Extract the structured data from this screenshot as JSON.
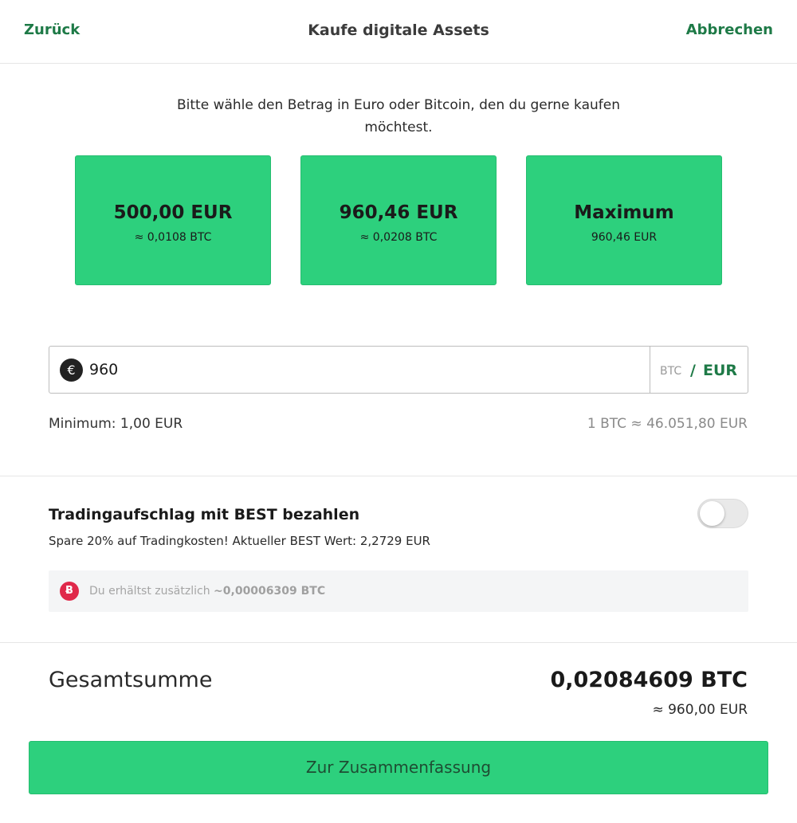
{
  "header": {
    "back_label": "Zurück",
    "title": "Kaufe digitale Assets",
    "cancel_label": "Abbrechen"
  },
  "intro_text": "Bitte wähle den Betrag in Euro oder Bitcoin, den du gerne kaufen möchtest.",
  "presets": [
    {
      "amount": "500,00 EUR",
      "sub": "≈ 0,0108 BTC"
    },
    {
      "amount": "960,46 EUR",
      "sub": "≈ 0,0208 BTC"
    },
    {
      "amount": "Maximum",
      "sub": "960,46 EUR"
    }
  ],
  "amount_input": {
    "currency_icon": "euro-icon",
    "value": "960",
    "unit_btc": "BTC",
    "unit_separator": "/",
    "unit_eur": "EUR"
  },
  "minimum_label": "Minimum: 1,00 EUR",
  "rate_label": "1 BTC ≈ 46.051,80 EUR",
  "best": {
    "title": "Tradingaufschlag mit BEST bezahlen",
    "subtitle": "Spare 20% auf Tradingkosten! Aktueller BEST Wert: 2,2729 EUR",
    "toggle_on": false,
    "bonus_icon": "best-token-icon",
    "bonus_text": "Du erhältst zusätzlich",
    "bonus_value": "~0,00006309 BTC"
  },
  "total": {
    "label": "Gesamtsumme",
    "btc": "0,02084609 BTC",
    "eur": "≈ 960,00 EUR"
  },
  "cta_label": "Zur Zusammenfassung",
  "colors": {
    "accent_green": "#2dd07d",
    "link_green": "#1e7a47",
    "best_red": "#e0294a"
  }
}
